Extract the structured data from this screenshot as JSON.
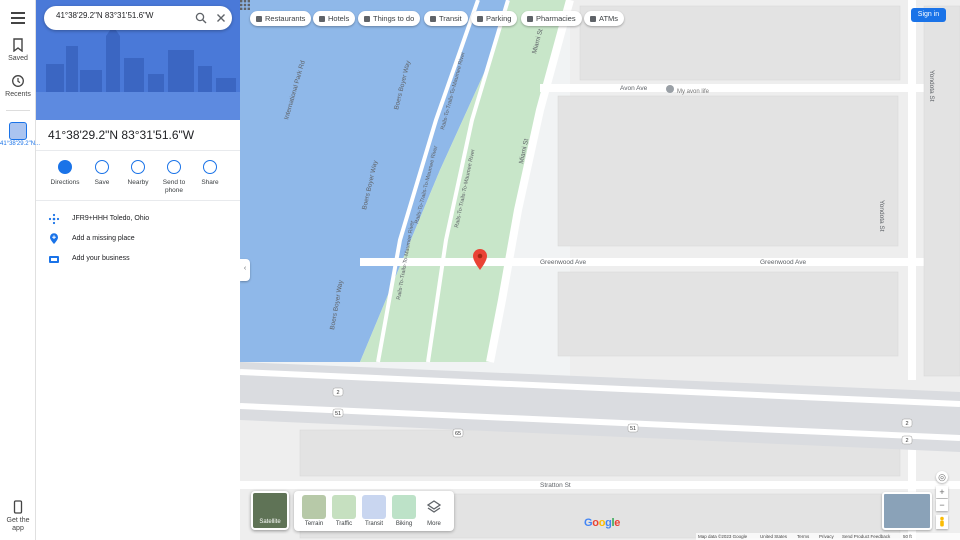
{
  "search": {
    "value": "41°38'29.2\"N 83°31'51.6\"W"
  },
  "rail": {
    "saved": "Saved",
    "recents": "Recents",
    "recent_item": "41°38'29.2\"N...",
    "get_app": "Get the app"
  },
  "place": {
    "title": "41°38'29.2\"N 83°31'51.6\"W",
    "actions": [
      {
        "label": "Directions",
        "icon": "directions-icon"
      },
      {
        "label": "Save",
        "icon": "bookmark-icon"
      },
      {
        "label": "Nearby",
        "icon": "nearby-icon"
      },
      {
        "label": "Send to phone",
        "icon": "phone-icon"
      },
      {
        "label": "Share",
        "icon": "share-icon"
      }
    ],
    "plus_code": "JFR9+HHH Toledo, Ohio",
    "add_place": "Add a missing place",
    "add_business": "Add your business"
  },
  "categories": [
    {
      "label": "Restaurants",
      "icon": "restaurant-icon"
    },
    {
      "label": "Hotels",
      "icon": "hotel-icon"
    },
    {
      "label": "Things to do",
      "icon": "camera-icon"
    },
    {
      "label": "Transit",
      "icon": "transit-icon"
    },
    {
      "label": "Parking",
      "icon": "parking-icon"
    },
    {
      "label": "Pharmacies",
      "icon": "pharmacy-icon"
    },
    {
      "label": "ATMs",
      "icon": "atm-icon"
    }
  ],
  "header": {
    "sign_in": "Sign in"
  },
  "layers": {
    "satellite": "Satellite",
    "items": [
      "Terrain",
      "Traffic",
      "Transit",
      "Biking",
      "More"
    ]
  },
  "map_labels": {
    "streets": {
      "miami": "Miami St",
      "avon": "Avon Ave",
      "greenwood": "Greenwood Ave",
      "greenwood_left": "Greenwood Ave",
      "stratton": "Stratton St",
      "yondota": "Yondota St",
      "intl_park": "International Park Rd",
      "boers_right": "Boers Boyer Way",
      "boers_mid": "Boers Boyer Way",
      "boers_left": "Boers Boyer Way",
      "rails1": "Rails-To-Trails-To-Maumee River",
      "rails2": "Rails-To-Trails-To-Maumee River",
      "rails3": "Rails-To-Trails-To-Maumee River",
      "rails4": "Rails-To-Trails-To-Maumee River"
    },
    "business": "My avon life",
    "shields": {
      "hw2a": "2",
      "hw2b": "2",
      "hw51a": "51",
      "hw51b": "51",
      "hw65": "65",
      "hw2c": "2"
    }
  },
  "footer": {
    "map_data": "Map data ©2023 Google",
    "country": "United States",
    "terms": "Terms",
    "privacy": "Privacy",
    "feedback": "Send Product Feedback",
    "scale": "50 ft"
  },
  "colors": {
    "accent": "#1a73e8",
    "pin": "#ea4335",
    "river": "#8fb8e9",
    "park": "#c8e6c9",
    "road": "#ffffff",
    "highway": "#9aa0a6"
  }
}
